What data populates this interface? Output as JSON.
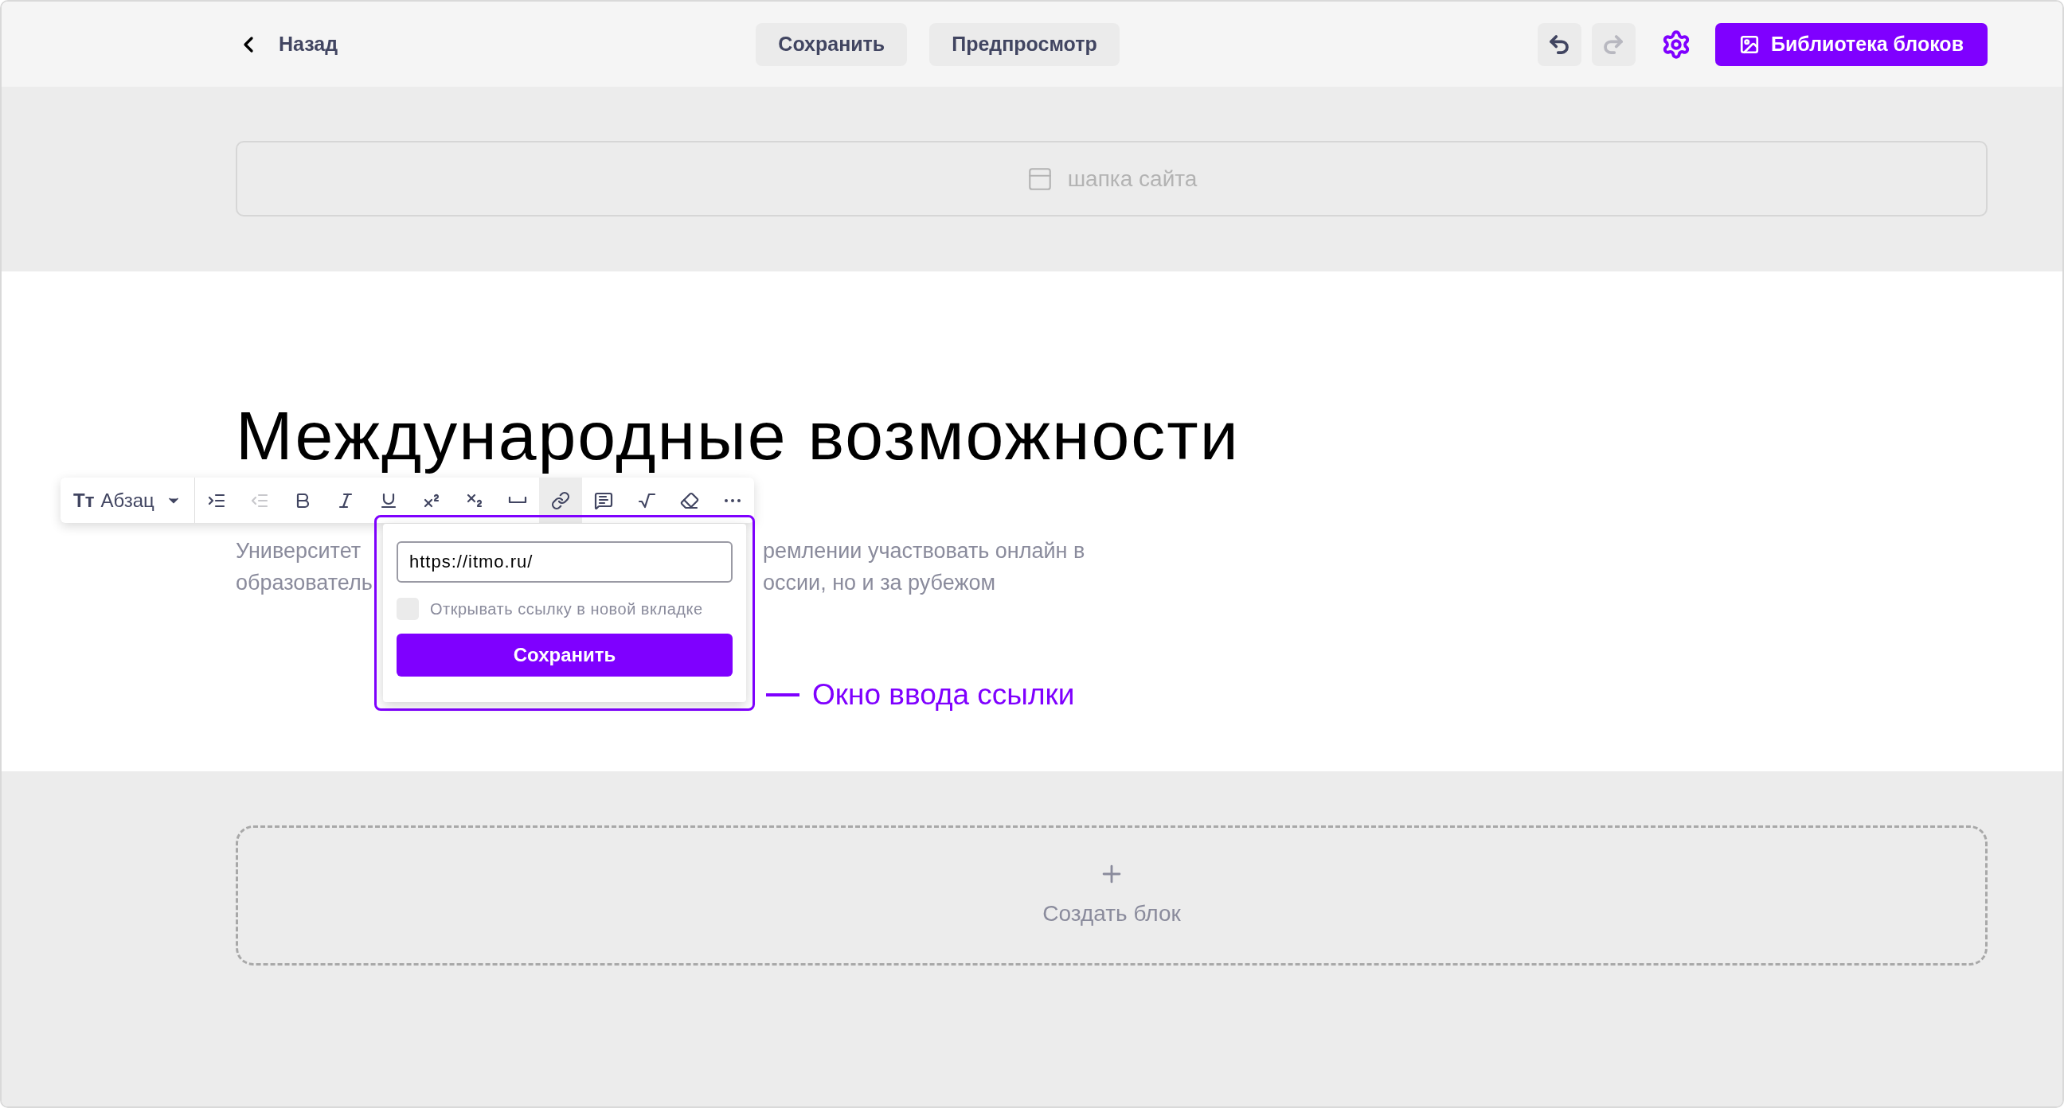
{
  "header": {
    "back": "Назад",
    "save": "Сохранить",
    "preview": "Предпросмотр",
    "undo": {
      "disabled": false
    },
    "redo": {
      "disabled": true
    },
    "library": "Библиотека блоков"
  },
  "site_header": {
    "label": "шапка сайта"
  },
  "content": {
    "title": "Международные возможности",
    "paragraph_lines": [
      {
        "left": "Университет",
        "right": "ремлении участвовать онлайн в"
      },
      {
        "left": "образователь",
        "right": "оссии, но и за рубежом"
      }
    ]
  },
  "toolbar": {
    "format": {
      "glyph": "Тт",
      "label": "Абзац"
    },
    "tools": [
      {
        "kind": "indent",
        "selected": false,
        "disabled": false
      },
      {
        "kind": "outdent",
        "selected": false,
        "disabled": true
      },
      {
        "kind": "bold",
        "selected": false,
        "disabled": false
      },
      {
        "kind": "italic",
        "selected": false,
        "disabled": false
      },
      {
        "kind": "underline",
        "selected": false,
        "disabled": false
      },
      {
        "kind": "superscript",
        "selected": false,
        "disabled": false
      },
      {
        "kind": "subscript",
        "selected": false,
        "disabled": false
      },
      {
        "kind": "space",
        "selected": false,
        "disabled": false
      },
      {
        "kind": "link",
        "selected": true,
        "disabled": false
      },
      {
        "kind": "comment",
        "selected": false,
        "disabled": false
      },
      {
        "kind": "formula",
        "selected": false,
        "disabled": false
      },
      {
        "kind": "eraser",
        "selected": false,
        "disabled": false
      },
      {
        "kind": "more",
        "selected": false,
        "disabled": false
      }
    ]
  },
  "link_popup": {
    "url": "https://itmo.ru/",
    "new_tab": {
      "label": "Открывать ссылку в новой вкладке",
      "checked": false
    },
    "save": "Сохранить"
  },
  "annotation": "Окно ввода ссылки",
  "create_block": {
    "label": "Создать блок"
  }
}
